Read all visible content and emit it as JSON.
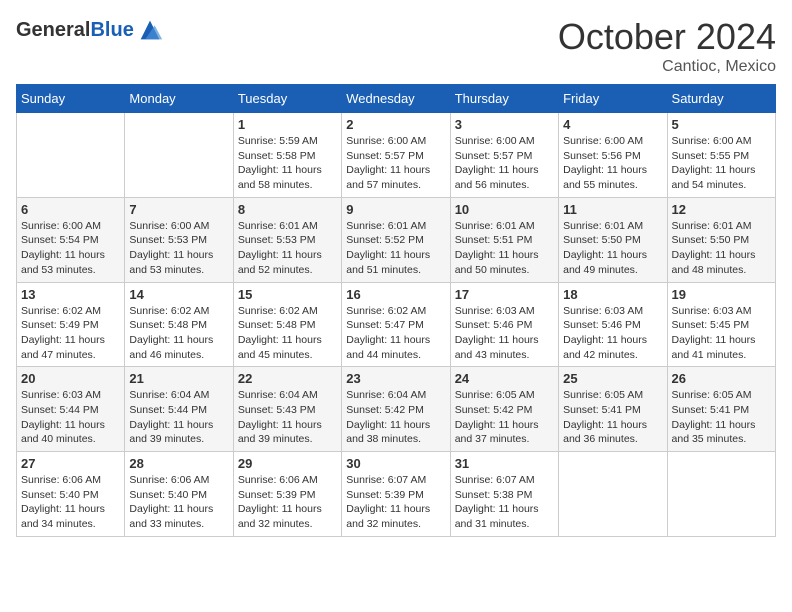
{
  "header": {
    "logo_general": "General",
    "logo_blue": "Blue",
    "month_title": "October 2024",
    "location": "Cantioc, Mexico"
  },
  "weekdays": [
    "Sunday",
    "Monday",
    "Tuesday",
    "Wednesday",
    "Thursday",
    "Friday",
    "Saturday"
  ],
  "weeks": [
    [
      {
        "day": "",
        "info": ""
      },
      {
        "day": "",
        "info": ""
      },
      {
        "day": "1",
        "info": "Sunrise: 5:59 AM\nSunset: 5:58 PM\nDaylight: 11 hours and 58 minutes."
      },
      {
        "day": "2",
        "info": "Sunrise: 6:00 AM\nSunset: 5:57 PM\nDaylight: 11 hours and 57 minutes."
      },
      {
        "day": "3",
        "info": "Sunrise: 6:00 AM\nSunset: 5:57 PM\nDaylight: 11 hours and 56 minutes."
      },
      {
        "day": "4",
        "info": "Sunrise: 6:00 AM\nSunset: 5:56 PM\nDaylight: 11 hours and 55 minutes."
      },
      {
        "day": "5",
        "info": "Sunrise: 6:00 AM\nSunset: 5:55 PM\nDaylight: 11 hours and 54 minutes."
      }
    ],
    [
      {
        "day": "6",
        "info": "Sunrise: 6:00 AM\nSunset: 5:54 PM\nDaylight: 11 hours and 53 minutes."
      },
      {
        "day": "7",
        "info": "Sunrise: 6:00 AM\nSunset: 5:53 PM\nDaylight: 11 hours and 53 minutes."
      },
      {
        "day": "8",
        "info": "Sunrise: 6:01 AM\nSunset: 5:53 PM\nDaylight: 11 hours and 52 minutes."
      },
      {
        "day": "9",
        "info": "Sunrise: 6:01 AM\nSunset: 5:52 PM\nDaylight: 11 hours and 51 minutes."
      },
      {
        "day": "10",
        "info": "Sunrise: 6:01 AM\nSunset: 5:51 PM\nDaylight: 11 hours and 50 minutes."
      },
      {
        "day": "11",
        "info": "Sunrise: 6:01 AM\nSunset: 5:50 PM\nDaylight: 11 hours and 49 minutes."
      },
      {
        "day": "12",
        "info": "Sunrise: 6:01 AM\nSunset: 5:50 PM\nDaylight: 11 hours and 48 minutes."
      }
    ],
    [
      {
        "day": "13",
        "info": "Sunrise: 6:02 AM\nSunset: 5:49 PM\nDaylight: 11 hours and 47 minutes."
      },
      {
        "day": "14",
        "info": "Sunrise: 6:02 AM\nSunset: 5:48 PM\nDaylight: 11 hours and 46 minutes."
      },
      {
        "day": "15",
        "info": "Sunrise: 6:02 AM\nSunset: 5:48 PM\nDaylight: 11 hours and 45 minutes."
      },
      {
        "day": "16",
        "info": "Sunrise: 6:02 AM\nSunset: 5:47 PM\nDaylight: 11 hours and 44 minutes."
      },
      {
        "day": "17",
        "info": "Sunrise: 6:03 AM\nSunset: 5:46 PM\nDaylight: 11 hours and 43 minutes."
      },
      {
        "day": "18",
        "info": "Sunrise: 6:03 AM\nSunset: 5:46 PM\nDaylight: 11 hours and 42 minutes."
      },
      {
        "day": "19",
        "info": "Sunrise: 6:03 AM\nSunset: 5:45 PM\nDaylight: 11 hours and 41 minutes."
      }
    ],
    [
      {
        "day": "20",
        "info": "Sunrise: 6:03 AM\nSunset: 5:44 PM\nDaylight: 11 hours and 40 minutes."
      },
      {
        "day": "21",
        "info": "Sunrise: 6:04 AM\nSunset: 5:44 PM\nDaylight: 11 hours and 39 minutes."
      },
      {
        "day": "22",
        "info": "Sunrise: 6:04 AM\nSunset: 5:43 PM\nDaylight: 11 hours and 39 minutes."
      },
      {
        "day": "23",
        "info": "Sunrise: 6:04 AM\nSunset: 5:42 PM\nDaylight: 11 hours and 38 minutes."
      },
      {
        "day": "24",
        "info": "Sunrise: 6:05 AM\nSunset: 5:42 PM\nDaylight: 11 hours and 37 minutes."
      },
      {
        "day": "25",
        "info": "Sunrise: 6:05 AM\nSunset: 5:41 PM\nDaylight: 11 hours and 36 minutes."
      },
      {
        "day": "26",
        "info": "Sunrise: 6:05 AM\nSunset: 5:41 PM\nDaylight: 11 hours and 35 minutes."
      }
    ],
    [
      {
        "day": "27",
        "info": "Sunrise: 6:06 AM\nSunset: 5:40 PM\nDaylight: 11 hours and 34 minutes."
      },
      {
        "day": "28",
        "info": "Sunrise: 6:06 AM\nSunset: 5:40 PM\nDaylight: 11 hours and 33 minutes."
      },
      {
        "day": "29",
        "info": "Sunrise: 6:06 AM\nSunset: 5:39 PM\nDaylight: 11 hours and 32 minutes."
      },
      {
        "day": "30",
        "info": "Sunrise: 6:07 AM\nSunset: 5:39 PM\nDaylight: 11 hours and 32 minutes."
      },
      {
        "day": "31",
        "info": "Sunrise: 6:07 AM\nSunset: 5:38 PM\nDaylight: 11 hours and 31 minutes."
      },
      {
        "day": "",
        "info": ""
      },
      {
        "day": "",
        "info": ""
      }
    ]
  ]
}
